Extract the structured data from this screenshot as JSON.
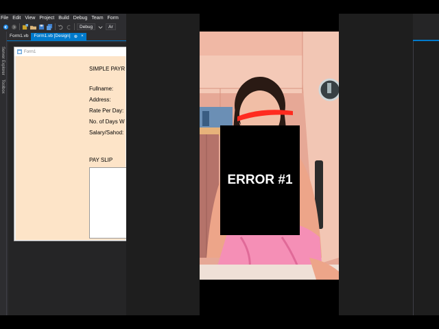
{
  "ide": {
    "menu": [
      "File",
      "Edit",
      "View",
      "Project",
      "Build",
      "Debug",
      "Team",
      "Form"
    ],
    "toolbar": {
      "config_dropdown": "Debug",
      "platform_dropdown": "Ar"
    },
    "tabs": [
      {
        "label": "Form1.vb",
        "active": false
      },
      {
        "label": "Form1.vb [Design]",
        "active": true,
        "pin": "⊕",
        "close": "×"
      }
    ],
    "side_panels": [
      "Server Explorer",
      "Toolbox"
    ]
  },
  "form": {
    "title": "Form1",
    "heading": "SIMPLE PAYR",
    "fields": [
      "Fullname:",
      "Address:",
      "Rate Per Day:",
      "No. of Days W",
      "Salary/Sahod:"
    ],
    "payslip_label": "PAY SLIP"
  },
  "video": {
    "overlay_text": "ERROR #1"
  },
  "colors": {
    "accent": "#007acc",
    "form_bg": "#fde4c8",
    "ide_bg": "#2d2d30"
  }
}
